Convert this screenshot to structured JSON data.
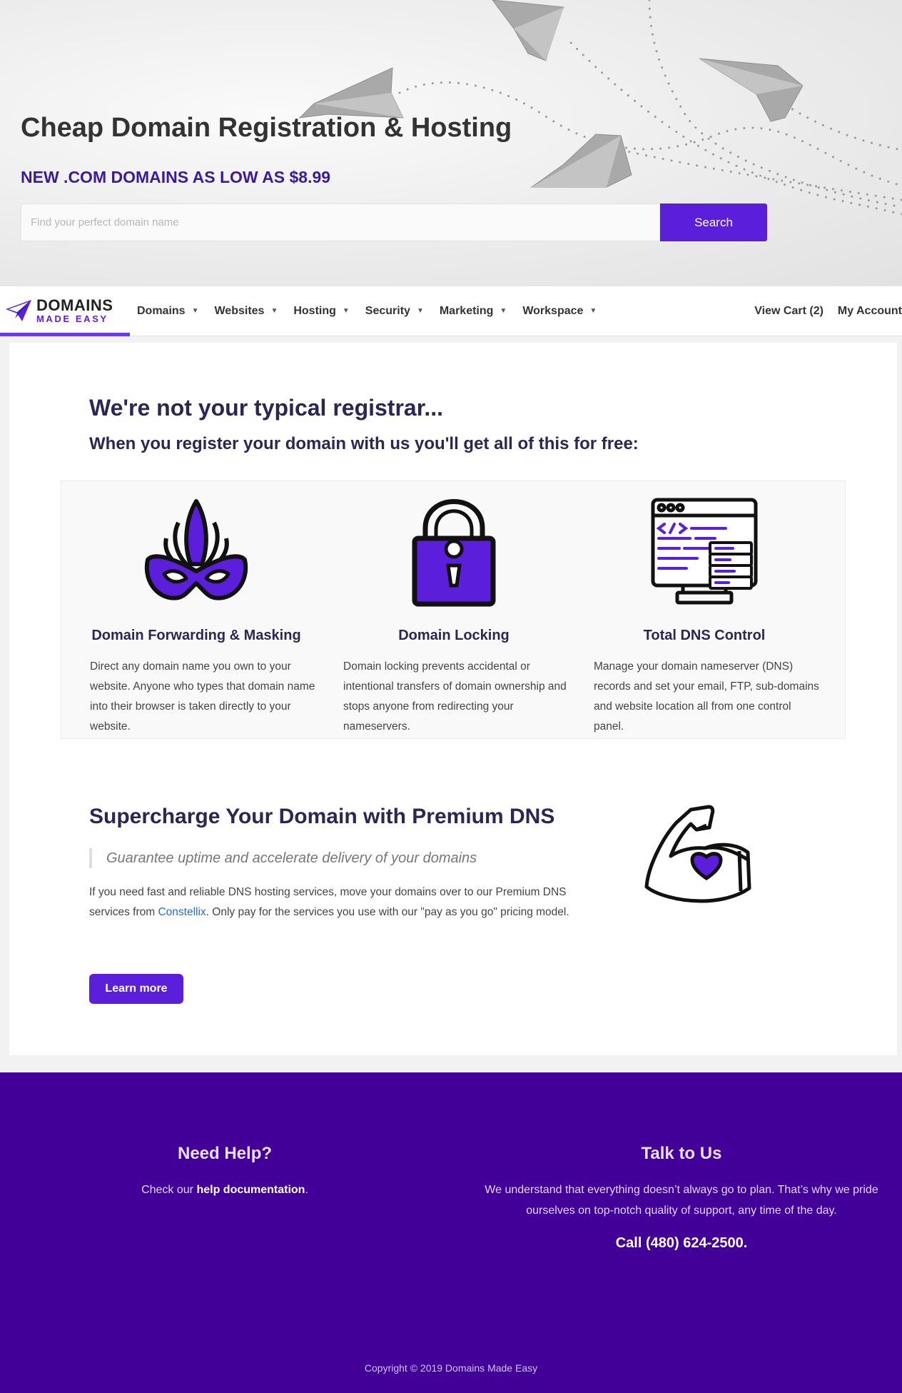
{
  "hero": {
    "title": "Cheap Domain Registration & Hosting",
    "subtitle": "NEW .COM DOMAINS AS LOW AS $8.99",
    "search_placeholder": "Find your perfect domain name",
    "search_button": "Search"
  },
  "nav": {
    "logo_line1": "DOMAINS",
    "logo_line2": "MADE EASY",
    "menu": [
      "Domains",
      "Websites",
      "Hosting",
      "Security",
      "Marketing",
      "Workspace"
    ],
    "cart": "View Cart (2)",
    "account": "My Account"
  },
  "intro": {
    "heading": "We're not your typical registrar...",
    "subheading": "When you register your domain with us you'll get all of this for free:"
  },
  "features": [
    {
      "icon": "mask-icon",
      "title": "Domain Forwarding & Masking",
      "description": "Direct any domain name you own to your website. Anyone who types that domain name into their browser is taken directly to your website."
    },
    {
      "icon": "padlock-icon",
      "title": "Domain Locking",
      "description": "Domain locking prevents accidental or intentional transfers of domain ownership and stops anyone from redirecting your nameservers."
    },
    {
      "icon": "server-code-icon",
      "title": "Total DNS Control",
      "description": "Manage your domain nameserver (DNS) records and set your email, FTP, sub-domains and website location all from one control panel."
    }
  ],
  "premium_dns": {
    "heading": "Supercharge Your Domain with Premium DNS",
    "quote": "Guarantee uptime and accelerate delivery of your domains",
    "body_before": "If you need fast and reliable DNS hosting services, move your domains over to our Premium DNS services from ",
    "link": "Constellix",
    "body_after": ". Only pay for the services you use with our \"pay as you go\" pricing model.",
    "button": "Learn more",
    "icon": "flexed-arm-heart-icon"
  },
  "footer": {
    "help_title": "Need Help?",
    "help_before": "Check our ",
    "help_link": "help documentation",
    "help_after": ".",
    "talk_title": "Talk to Us",
    "talk_text": "We understand that everything doesn’t always go to plan. That’s why we pride ourselves on top-notch quality of support, any time of the day.",
    "call": "Call (480) 624-2500.",
    "copyright": "Copyright © 2019 Domains Made Easy"
  },
  "colors": {
    "accent": "#5b1fdc",
    "heading": "#2b2652",
    "footer_bg": "#430099",
    "link": "#1f6fd6"
  }
}
